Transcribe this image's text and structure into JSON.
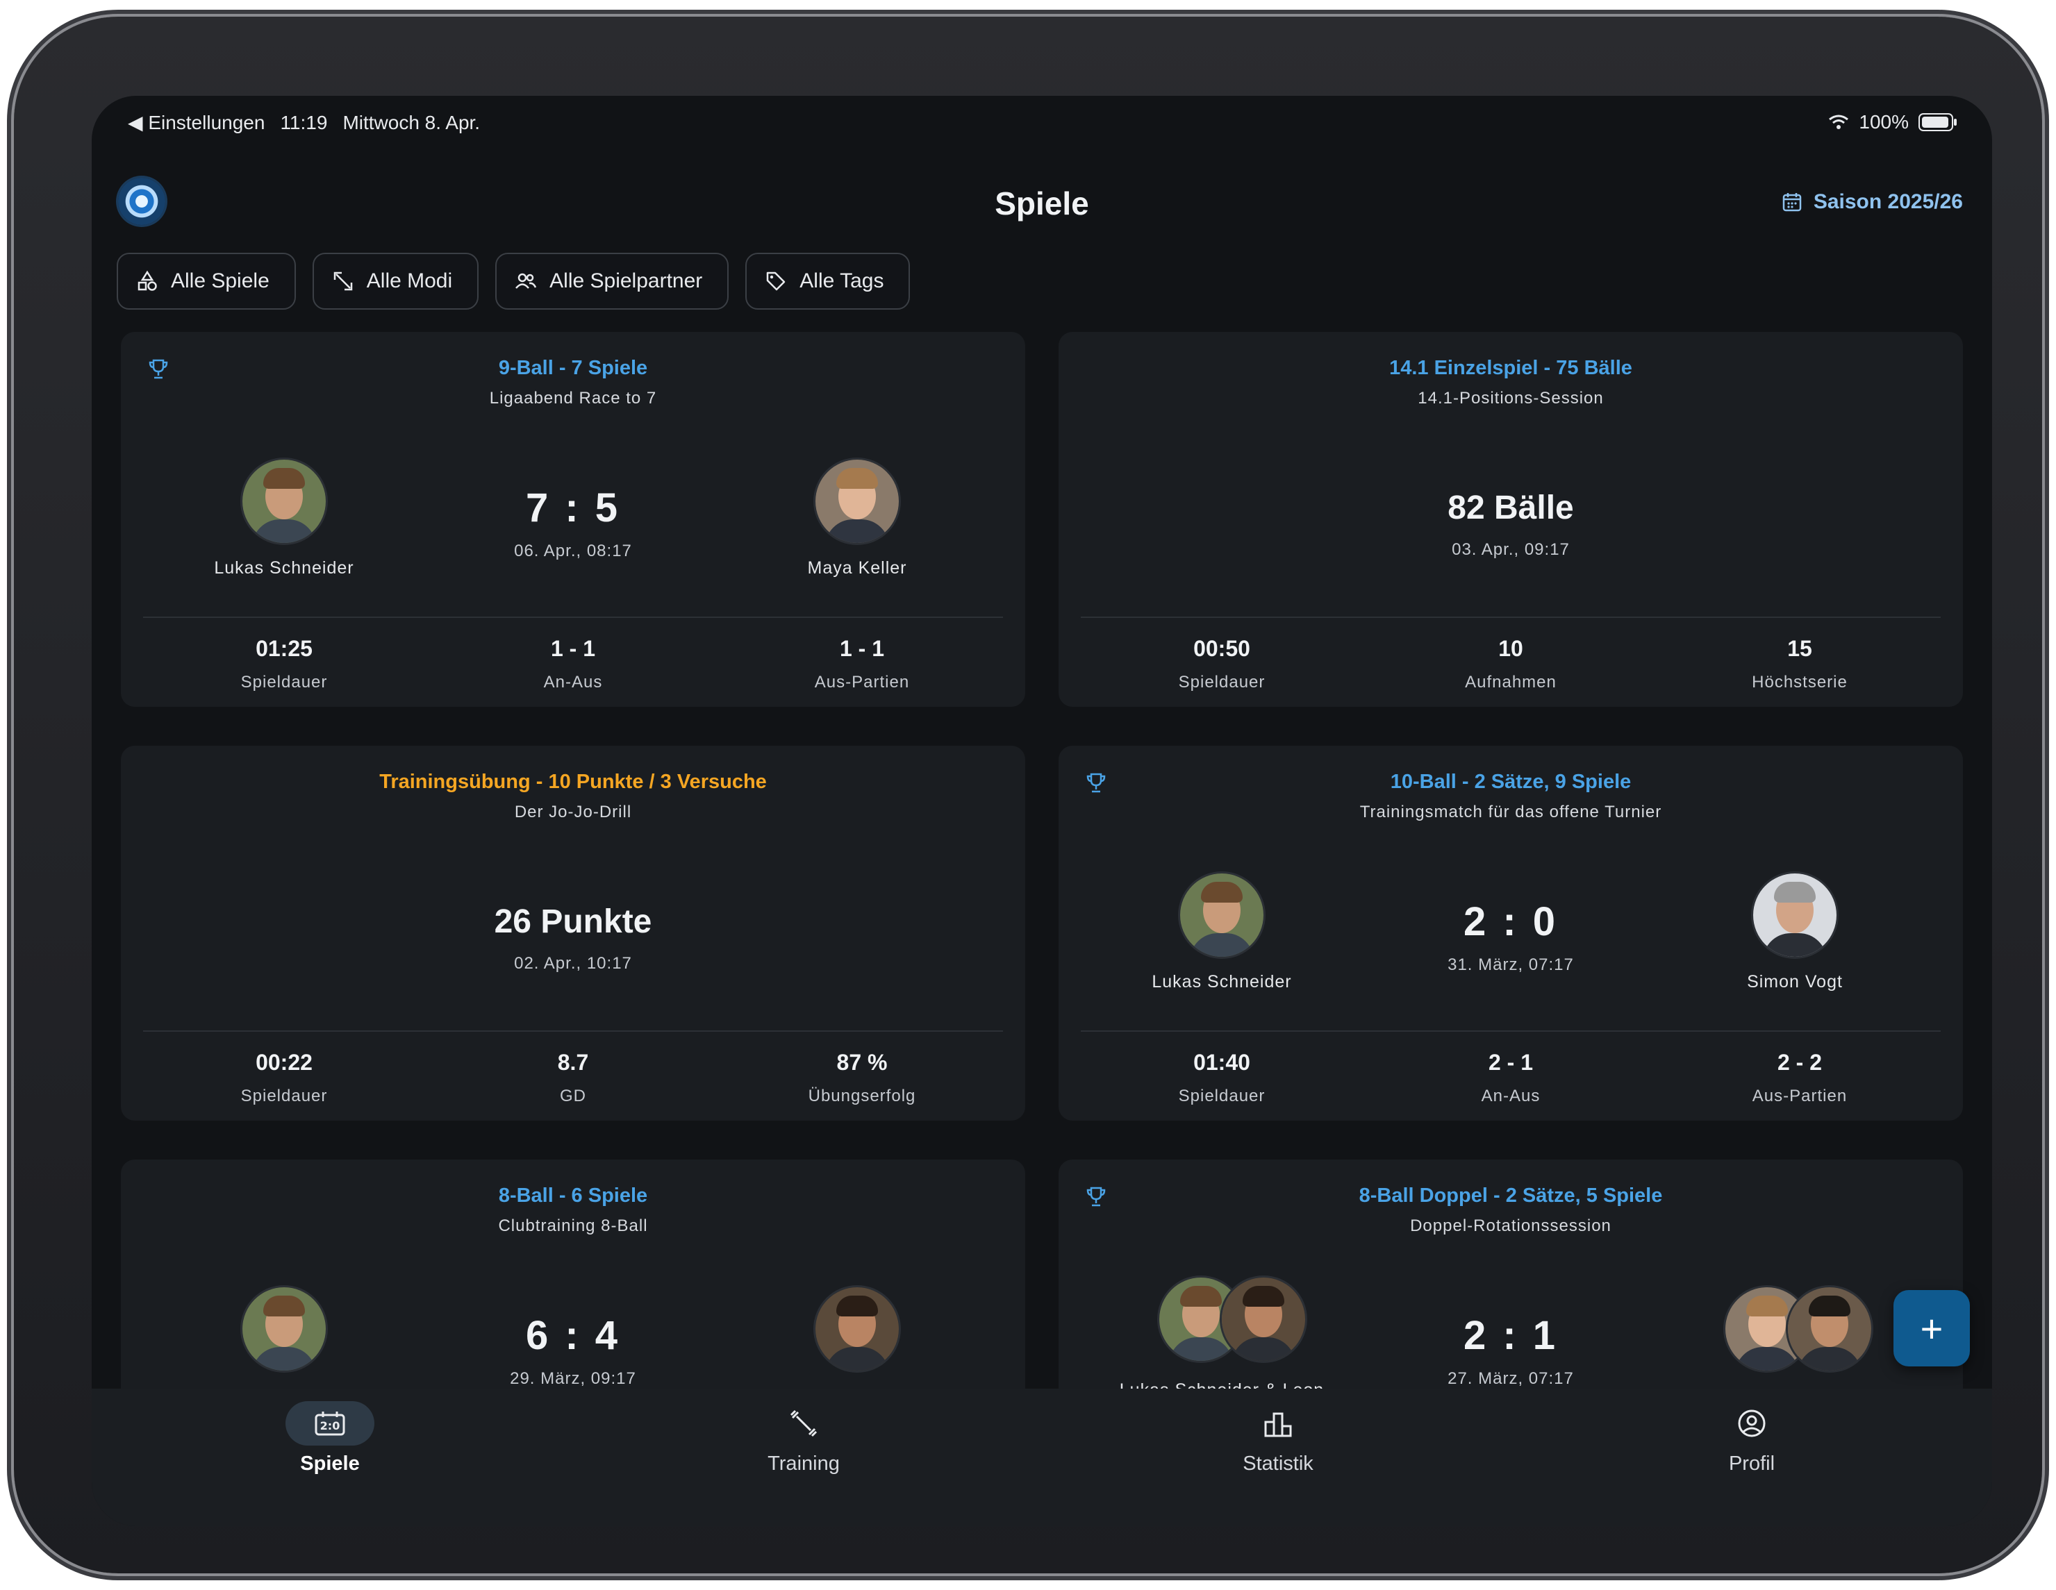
{
  "status": {
    "back_label": "◀ Einstellungen",
    "time": "11:19",
    "date": "Mittwoch 8. Apr.",
    "battery": "100%"
  },
  "header": {
    "title": "Spiele",
    "season": "Saison 2025/26"
  },
  "filters": [
    {
      "label": "Alle Spiele",
      "icon": "shapes-icon"
    },
    {
      "label": "Alle Modi",
      "icon": "arrows-icon"
    },
    {
      "label": "Alle Spielpartner",
      "icon": "users-icon"
    },
    {
      "label": "Alle Tags",
      "icon": "tag-icon"
    }
  ],
  "cards": [
    {
      "title": "9-Ball - 7 Spiele",
      "subtitle": "Ligaabend Race to 7",
      "player_left": "Lukas Schneider",
      "player_right": "Maya Keller",
      "score": "7 : 5",
      "date": "06. Apr., 08:17",
      "stats": [
        {
          "value": "01:25",
          "label": "Spieldauer"
        },
        {
          "value": "1 - 1",
          "label": "An-Aus"
        },
        {
          "value": "1 - 1",
          "label": "Aus-Partien"
        }
      ]
    },
    {
      "title": "14.1 Einzelspiel - 75 Bälle",
      "subtitle": "14.1-Positions-Session",
      "big": "82 Bälle",
      "date": "03. Apr., 09:17",
      "stats": [
        {
          "value": "00:50",
          "label": "Spieldauer"
        },
        {
          "value": "10",
          "label": "Aufnahmen"
        },
        {
          "value": "15",
          "label": "Höchstserie"
        }
      ]
    },
    {
      "title": "Trainingsübung - 10 Punkte / 3 Versuche",
      "subtitle": "Der Jo-Jo-Drill",
      "big": "26 Punkte",
      "date": "02. Apr., 10:17",
      "stats": [
        {
          "value": "00:22",
          "label": "Spieldauer"
        },
        {
          "value": "8.7",
          "label": "GD"
        },
        {
          "value": "87 %",
          "label": "Übungserfolg"
        }
      ]
    },
    {
      "title": "10-Ball - 2 Sätze, 9 Spiele",
      "subtitle": "Trainingsmatch für das offene Turnier",
      "player_left": "Lukas Schneider",
      "player_right": "Simon Vogt",
      "score": "2 : 0",
      "date": "31. März, 07:17",
      "stats": [
        {
          "value": "01:40",
          "label": "Spieldauer"
        },
        {
          "value": "2 - 1",
          "label": "An-Aus"
        },
        {
          "value": "2 - 2",
          "label": "Aus-Partien"
        }
      ]
    },
    {
      "title": "8-Ball - 6 Spiele",
      "subtitle": "Clubtraining 8-Ball",
      "score": "6 : 4",
      "date": "29. März, 09:17"
    },
    {
      "title": "8-Ball Doppel - 2 Sätze, 5 Spiele",
      "subtitle": "Doppel-Rotationssession",
      "player_left": "Lukas Schneider & Leon",
      "score": "2 : 1",
      "date": "27. März, 07:17"
    }
  ],
  "tabs": [
    {
      "label": "Spiele",
      "icon": "scoreboard-icon"
    },
    {
      "label": "Training",
      "icon": "dumbbell-icon"
    },
    {
      "label": "Statistik",
      "icon": "podium-icon"
    },
    {
      "label": "Profil",
      "icon": "person-circle-icon"
    }
  ],
  "colors": {
    "accent_blue": "#4aa3e6",
    "accent_orange": "#f5a623",
    "background": "#111316",
    "card": "#1a1d21",
    "fab": "#0f5a8f"
  }
}
